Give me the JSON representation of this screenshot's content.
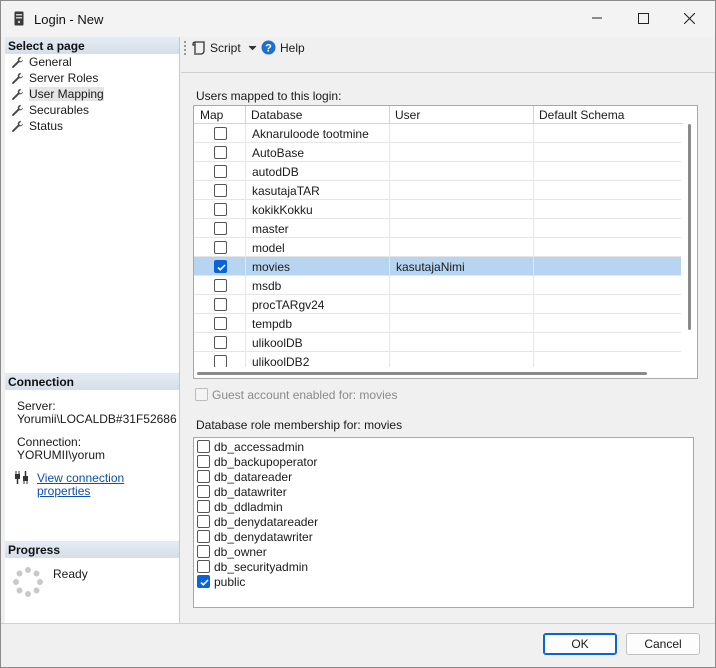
{
  "window": {
    "title": "Login - New"
  },
  "left": {
    "select_page_header": "Select a page",
    "pages": [
      {
        "label": "General"
      },
      {
        "label": "Server Roles"
      },
      {
        "label": "User Mapping"
      },
      {
        "label": "Securables"
      },
      {
        "label": "Status"
      }
    ],
    "connection_header": "Connection",
    "server_label": "Server:",
    "server_value": "Yorumii\\LOCALDB#31F52686",
    "connection_label": "Connection:",
    "connection_value": "YORUMII\\yorum",
    "view_connection_link": "View connection properties",
    "progress_header": "Progress",
    "progress_status": "Ready"
  },
  "toolbar": {
    "script_label": "Script",
    "help_label": "Help"
  },
  "mapping": {
    "label": "Users mapped to this login:",
    "columns": {
      "map": "Map",
      "database": "Database",
      "user": "User",
      "default_schema": "Default Schema"
    },
    "rows": [
      {
        "database": "Aknaruloode tootmine",
        "user": "",
        "schema": "",
        "checked": false
      },
      {
        "database": "AutoBase",
        "user": "",
        "schema": "",
        "checked": false
      },
      {
        "database": "autodDB",
        "user": "",
        "schema": "",
        "checked": false
      },
      {
        "database": "kasutajaTAR",
        "user": "",
        "schema": "",
        "checked": false
      },
      {
        "database": "kokikKokku",
        "user": "",
        "schema": "",
        "checked": false
      },
      {
        "database": "master",
        "user": "",
        "schema": "",
        "checked": false
      },
      {
        "database": "model",
        "user": "",
        "schema": "",
        "checked": false
      },
      {
        "database": "movies",
        "user": "kasutajaNimi",
        "schema": "",
        "checked": true
      },
      {
        "database": "msdb",
        "user": "",
        "schema": "",
        "checked": false
      },
      {
        "database": "procTARgv24",
        "user": "",
        "schema": "",
        "checked": false
      },
      {
        "database": "tempdb",
        "user": "",
        "schema": "",
        "checked": false
      },
      {
        "database": "ulikoolDB",
        "user": "",
        "schema": "",
        "checked": false
      },
      {
        "database": "ulikoolDB2",
        "user": "",
        "schema": "",
        "checked": false
      }
    ],
    "guest_label": "Guest account enabled for: movies"
  },
  "roles": {
    "label": "Database role membership for: movies",
    "items": [
      {
        "name": "db_accessadmin",
        "checked": false
      },
      {
        "name": "db_backupoperator",
        "checked": false
      },
      {
        "name": "db_datareader",
        "checked": false
      },
      {
        "name": "db_datawriter",
        "checked": false
      },
      {
        "name": "db_ddladmin",
        "checked": false
      },
      {
        "name": "db_denydatareader",
        "checked": false
      },
      {
        "name": "db_denydatawriter",
        "checked": false
      },
      {
        "name": "db_owner",
        "checked": false
      },
      {
        "name": "db_securityadmin",
        "checked": false
      },
      {
        "name": "public",
        "checked": true
      }
    ]
  },
  "buttons": {
    "ok": "OK",
    "cancel": "Cancel"
  },
  "colors": {
    "accent": "#0a64d6",
    "selected_row": "#b7d5f0",
    "link": "#0b4fb3"
  }
}
